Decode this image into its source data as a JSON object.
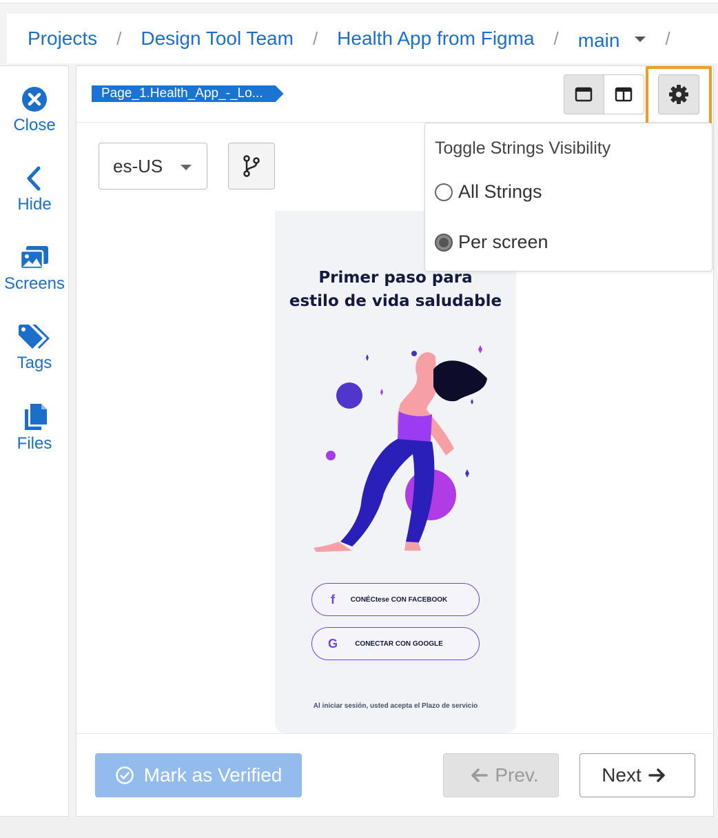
{
  "breadcrumb": {
    "items": [
      "Projects",
      "Design Tool Team",
      "Health App from Figma"
    ],
    "branch": "main",
    "separator": "/"
  },
  "sidebar": {
    "items": [
      {
        "label": "Close",
        "icon": "close-circle-icon"
      },
      {
        "label": "Hide",
        "icon": "chevron-left-icon"
      },
      {
        "label": "Screens",
        "icon": "images-icon"
      },
      {
        "label": "Tags",
        "icon": "tags-icon"
      },
      {
        "label": "Files",
        "icon": "files-icon"
      }
    ]
  },
  "header": {
    "page_tag": "Page_1.Health_App_-_Lo..."
  },
  "locale": {
    "selected": "es-US"
  },
  "phone": {
    "title_line1": "Primer paso para",
    "title_line2": "estilo de vida saludable",
    "facebook_icon": "f",
    "facebook_label": "CONÉCtese CON FACEBOOK",
    "google_icon": "G",
    "google_label": "CONECTAR CON GOOGLE",
    "terms": "Al iniciar sesión, usted acepta el Plazo de servicio"
  },
  "popover": {
    "title": "Toggle Strings Visibility",
    "options": [
      {
        "label": "All Strings",
        "checked": false
      },
      {
        "label": "Per screen",
        "checked": true
      }
    ]
  },
  "footer": {
    "verify_label": "Mark as Verified",
    "prev_label": "Prev.",
    "next_label": "Next"
  },
  "colors": {
    "link": "#1b6fc9",
    "highlight": "#f59a23",
    "verify_bg": "#93bbeb",
    "brand_purple": "#6b45e0"
  }
}
